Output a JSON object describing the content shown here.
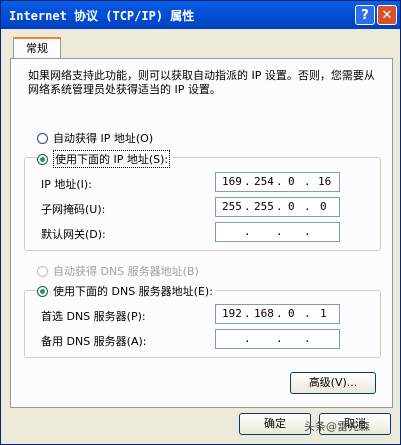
{
  "window": {
    "title": "Internet 协议 (TCP/IP) 属性",
    "help": "?",
    "close": "✕"
  },
  "tab": "常规",
  "description": "如果网络支持此功能，则可以获取自动指派的 IP 设置。否则，您需要从网络系统管理员处获得适当的 IP 设置。",
  "ip_mode": {
    "auto_label": "自动获得 IP 地址(O)",
    "manual_label": "使用下面的 IP 地址(S):",
    "selected": "manual"
  },
  "ip_fields": [
    {
      "label": "IP 地址(I):",
      "octets": [
        "169",
        "254",
        "0",
        "16"
      ]
    },
    {
      "label": "子网掩码(U):",
      "octets": [
        "255",
        "255",
        "0",
        "0"
      ]
    },
    {
      "label": "默认网关(D):",
      "octets": [
        "",
        "",
        "",
        ""
      ]
    }
  ],
  "dns_mode": {
    "auto_label": "自动获得 DNS 服务器地址(B)",
    "manual_label": "使用下面的 DNS 服务器地址(E):",
    "selected": "manual"
  },
  "dns_fields": [
    {
      "label": "首选 DNS 服务器(P):",
      "octets": [
        "192",
        "168",
        "0",
        "1"
      ]
    },
    {
      "label": "备用 DNS 服务器(A):",
      "octets": [
        "",
        "",
        "",
        ""
      ]
    }
  ],
  "buttons": {
    "advanced": "高级(V)...",
    "ok": "确定",
    "cancel": "取消"
  },
  "watermark": "头条@雷先森"
}
